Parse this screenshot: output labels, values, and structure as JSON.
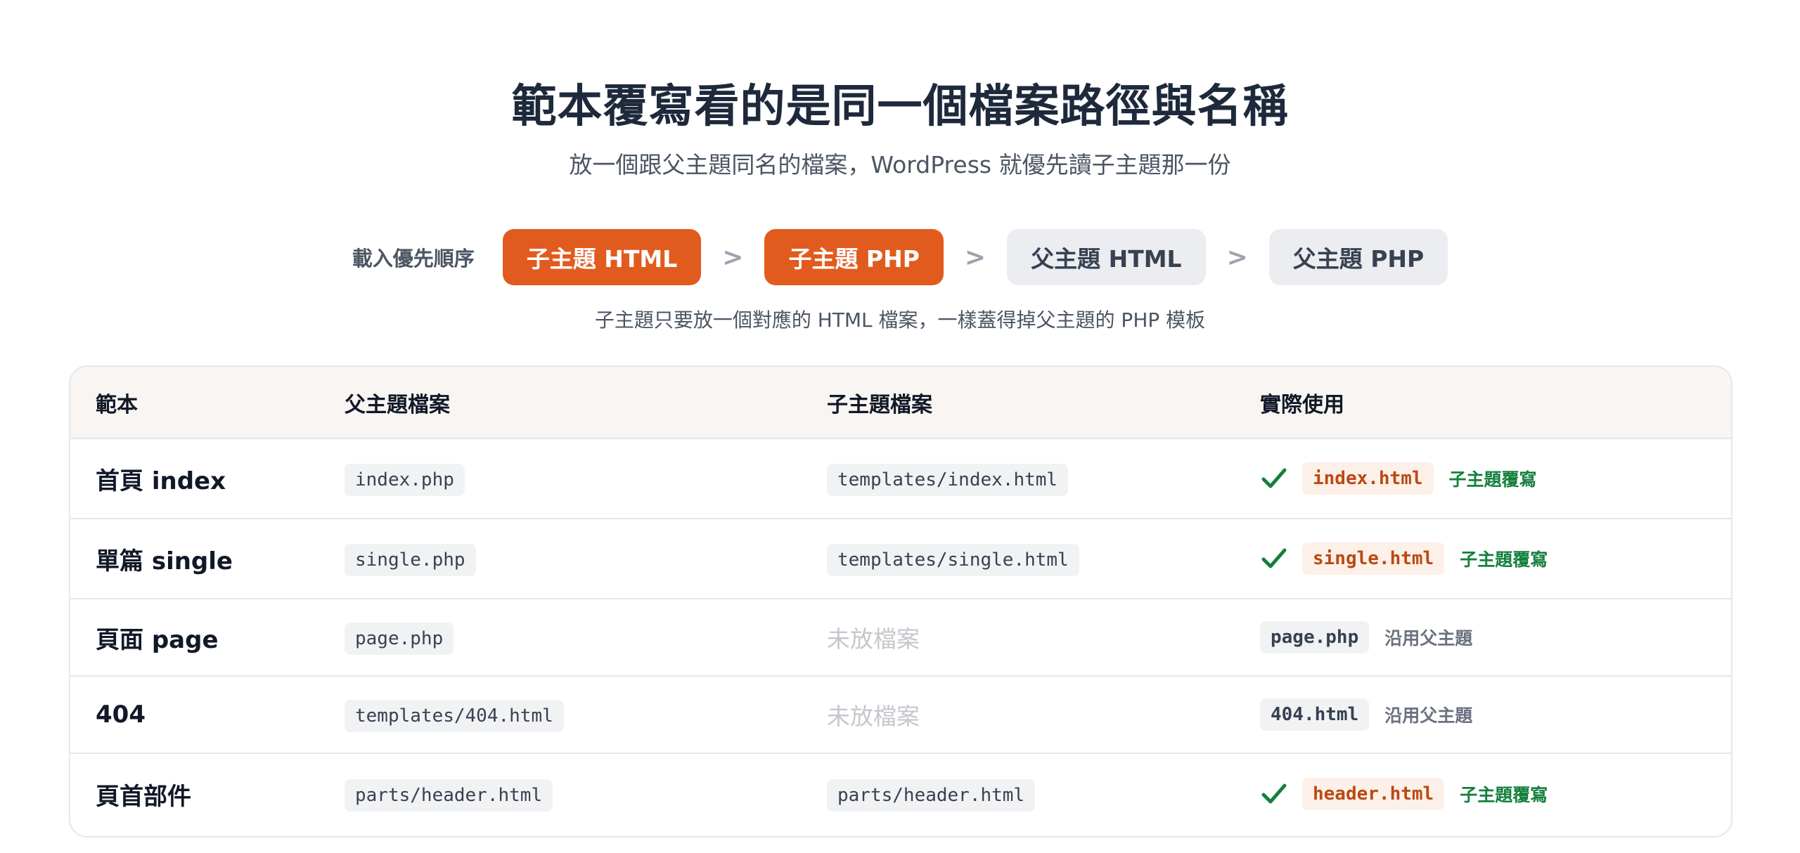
{
  "header": {
    "title": "範本覆寫看的是同一個檔案路徑與名稱",
    "subtitle": "放一個跟父主題同名的檔案，WordPress 就優先讀子主題那一份"
  },
  "priority": {
    "label": "載入優先順序",
    "separator": ">",
    "steps": [
      "子主題 HTML",
      "子主題 PHP",
      "父主題 HTML",
      "父主題 PHP"
    ],
    "note": "子主題只要放一個對應的 HTML 檔案，一樣蓋得掉父主題的 PHP 模板"
  },
  "table": {
    "columns": [
      "範本",
      "父主題檔案",
      "子主題檔案",
      "實際使用"
    ],
    "rows": [
      {
        "template": "首頁 index",
        "parent_file": "index.php",
        "child_file": "templates/index.html",
        "result_file": "index.html",
        "result_note": "子主題覆寫"
      },
      {
        "template": "單篇 single",
        "parent_file": "single.php",
        "child_file": "templates/single.html",
        "result_file": "single.html",
        "result_note": "子主題覆寫"
      },
      {
        "template": "頁面 page",
        "parent_file": "page.php",
        "child_file": "未放檔案",
        "result_file": "page.php",
        "result_note": "沿用父主題"
      },
      {
        "template": "404",
        "parent_file": "templates/404.html",
        "child_file": "未放檔案",
        "result_file": "404.html",
        "result_note": "沿用父主題"
      },
      {
        "template": "頁首部件",
        "parent_file": "parts/header.html",
        "child_file": "parts/header.html",
        "result_file": "header.html",
        "result_note": "子主題覆寫"
      }
    ]
  },
  "colors": {
    "accent": "#e25b1e",
    "success": "#15803d",
    "muted": "#6b7280"
  }
}
